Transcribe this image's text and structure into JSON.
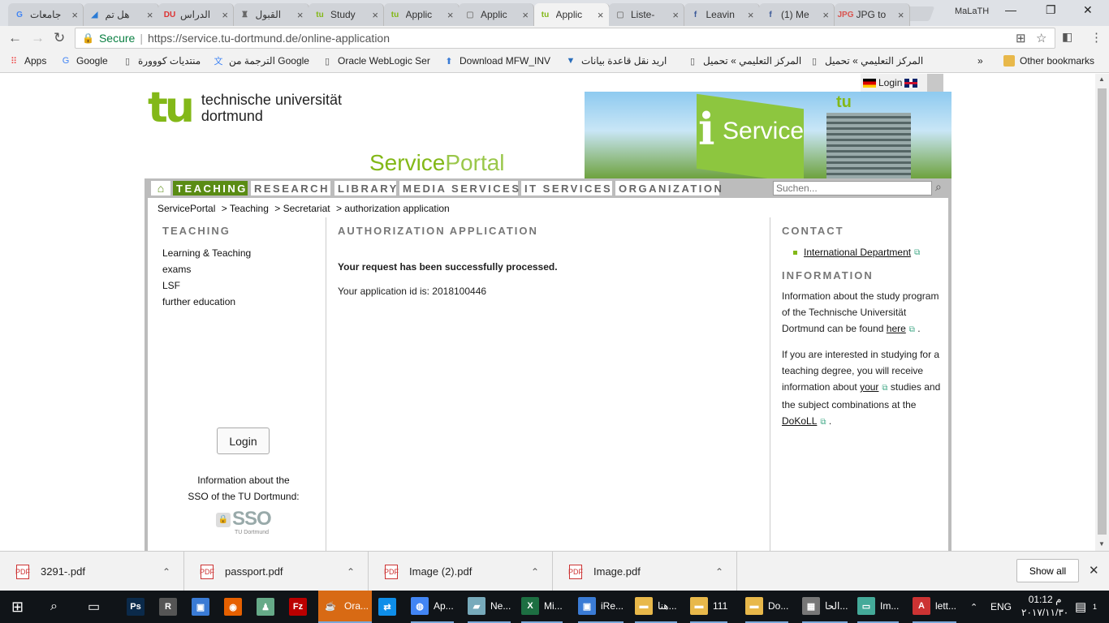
{
  "browser": {
    "tabs": [
      {
        "title": "جامعات",
        "favicon": "G",
        "color": "#4285f4"
      },
      {
        "title": "هل تم",
        "favicon": "◢",
        "color": "#2a7bd5"
      },
      {
        "title": "الدراس",
        "favicon": "DU",
        "color": "#d33"
      },
      {
        "title": "القبول",
        "favicon": "♜",
        "color": "#666"
      },
      {
        "title": "Study",
        "favicon": "tu",
        "color": "#83b818"
      },
      {
        "title": "Applic",
        "favicon": "tu",
        "color": "#83b818"
      },
      {
        "title": "Applic",
        "favicon": "▢",
        "color": "#888"
      },
      {
        "title": "Applic",
        "favicon": "tu",
        "color": "#83b818"
      },
      {
        "title": "Liste-",
        "favicon": "▢",
        "color": "#888"
      },
      {
        "title": "Leavin",
        "favicon": "f",
        "color": "#3b5998"
      },
      {
        "title": "(1) Me",
        "favicon": "f",
        "color": "#3b5998"
      },
      {
        "title": "JPG to",
        "favicon": "JPG",
        "color": "#d9534f"
      }
    ],
    "active_tab_index": 7,
    "window_user": "MaLaTH",
    "window_buttons": {
      "minimize": "—",
      "restore": "❐",
      "close": "✕"
    },
    "nav": {
      "back": "←",
      "forward": "→",
      "reload": "↻"
    },
    "address": {
      "secure_label": "Secure",
      "url": "https://service.tu-dortmund.de/online-application"
    },
    "bookmarks": [
      {
        "label": "Apps",
        "icon": "apps-grid-icon"
      },
      {
        "label": "Google",
        "icon": "google-icon"
      },
      {
        "label": "منتديات كووورة",
        "icon": "page-icon"
      },
      {
        "label": "الترجمة من Google",
        "icon": "translate-icon"
      },
      {
        "label": "Oracle WebLogic Ser",
        "icon": "page-icon"
      },
      {
        "label": "Download MFW_INV",
        "icon": "download-arrow-icon"
      },
      {
        "label": "اريد نقل قاعدة بيانات",
        "icon": "v-icon"
      },
      {
        "label": "المركز التعليمي » تحميل",
        "icon": "page-icon"
      },
      {
        "label": "المركز التعليمي » تحميل",
        "icon": "page-icon"
      }
    ],
    "other_bookmarks": "Other bookmarks",
    "more_bookmarks": "»"
  },
  "page": {
    "login_label": "Login",
    "logo": {
      "mark": "tu",
      "line1": "technische universität",
      "line2": "dortmund"
    },
    "portal_title": {
      "part1": "Service",
      "part2": "Portal"
    },
    "banner": {
      "i": "i",
      "text": "Service",
      "tu": "tu"
    },
    "nav": [
      {
        "label": "TEACHING",
        "active": true
      },
      {
        "label": "RESEARCH",
        "active": false
      },
      {
        "label": "LIBRARY",
        "active": false
      },
      {
        "label": "MEDIA SERVICES",
        "active": false
      },
      {
        "label": "IT SERVICES",
        "active": false
      },
      {
        "label": "ORGANIZATION",
        "active": false
      }
    ],
    "search_placeholder": "Suchen...",
    "breadcrumb": [
      "ServicePortal",
      "> Teaching",
      "> Secretariat",
      "> authorization application"
    ],
    "left": {
      "heading": "TEACHING",
      "links": [
        "Learning & Teaching",
        "exams",
        "LSF",
        "further education"
      ],
      "login_button": "Login",
      "sso_info_line1": "Information about the",
      "sso_info_line2": "SSO of the TU Dortmund:",
      "sso_logo": "SSO",
      "sso_logo_sub": "TU Dortmund"
    },
    "center": {
      "heading": "AUTHORIZATION APPLICATION",
      "success": "Your request has been successfully processed.",
      "application_id": "Your application id is: 2018100446"
    },
    "right": {
      "contact_heading": "CONTACT",
      "contact_link": "International Department",
      "info_heading": "INFORMATION",
      "p1_text": "Information about the study program of the Technische Universität Dortmund can be found",
      "p1_link": "here",
      "p1_end": ".",
      "p2_text": "If you are interested in studying for a teaching degree, you will receive information about",
      "p2_link": "your",
      "p2_mid": "studies and the subject combinations at the",
      "p2_link2": "DoKoLL",
      "p2_end": "."
    }
  },
  "downloads": {
    "items": [
      "3291-.pdf",
      "passport.pdf",
      "Image (2).pdf",
      "Image.pdf"
    ],
    "show_all": "Show all"
  },
  "taskbar": {
    "apps": [
      {
        "label": "",
        "icon": "Ps",
        "color": "#0b2a4a"
      },
      {
        "label": "",
        "icon": "R",
        "color": "#555"
      },
      {
        "label": "",
        "icon": "▣",
        "color": "#3a7bd5"
      },
      {
        "label": "",
        "icon": "◉",
        "color": "#e66000"
      },
      {
        "label": "",
        "icon": "♟",
        "color": "#6a8"
      },
      {
        "label": "",
        "icon": "Fz",
        "color": "#b00"
      },
      {
        "label": "Ora...",
        "icon": "☕",
        "color": "#d86a14"
      },
      {
        "label": "",
        "icon": "⇄",
        "color": "#0e8ee9"
      },
      {
        "label": "Ap...",
        "icon": "◍",
        "color": "#4285f4"
      },
      {
        "label": "Ne...",
        "icon": "▰",
        "color": "#7ab"
      },
      {
        "label": "Mi...",
        "icon": "X",
        "color": "#1d6f42"
      },
      {
        "label": "iRe...",
        "icon": "▣",
        "color": "#3a7bd5"
      },
      {
        "label": "هنا...",
        "icon": "▬",
        "color": "#e8b84a"
      },
      {
        "label": "111",
        "icon": "▬",
        "color": "#e8b84a"
      },
      {
        "label": "Do...",
        "icon": "▬",
        "color": "#e8b84a"
      },
      {
        "label": "الحا...",
        "icon": "▦",
        "color": "#777"
      },
      {
        "label": "Im...",
        "icon": "▭",
        "color": "#4a9"
      },
      {
        "label": "lett...",
        "icon": "A",
        "color": "#c33"
      }
    ],
    "lang": "ENG",
    "time": "01:12 م",
    "date": "٢٠١٧/١١/٣٠",
    "notification_count": "1"
  },
  "colors": {
    "tu_green": "#83b818",
    "nav_active": "#5a8c14",
    "secure_green": "#0b8043"
  }
}
